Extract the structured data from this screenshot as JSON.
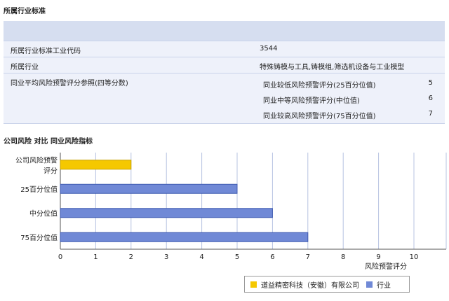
{
  "section1": {
    "title": "所属行业标准",
    "rows": [
      {
        "label": "所属行业标准工业代码",
        "value": "3544"
      },
      {
        "label": "所属行业",
        "value": "特殊铸模与工具,铸模组,筛选机设备与工业模型"
      }
    ],
    "ref": {
      "label": "同业平均风险预警评分参照(四等分数)",
      "items": [
        {
          "label": "同业较低风险预警评分(25百分位值)",
          "value": "5"
        },
        {
          "label": "同业中等风险预警评分(中位值)",
          "value": "6"
        },
        {
          "label": "同业较高风险预警评分(75百分位值)",
          "value": "7"
        }
      ]
    }
  },
  "section2": {
    "title": "公司风险 对比 同业风险指标"
  },
  "colors": {
    "company": "#f5c800",
    "industry": "#7089d6"
  },
  "chart_data": {
    "type": "bar",
    "orientation": "horizontal",
    "categories": [
      "公司风险预警评分",
      "25百分位值",
      "中分位值",
      "75百分位值"
    ],
    "series": [
      {
        "name": "道益精密科技（安徽）有限公司",
        "color": "#f5c800",
        "values": [
          2,
          null,
          null,
          null
        ]
      },
      {
        "name": "行业",
        "color": "#7089d6",
        "values": [
          null,
          5,
          6,
          7
        ]
      }
    ],
    "xlabel": "风险预警评分",
    "xlim": [
      0,
      10
    ],
    "xticks": [
      0,
      1,
      2,
      3,
      4,
      5,
      6,
      7,
      8,
      9,
      10
    ],
    "grid": true,
    "legend_position": "bottom-right"
  }
}
